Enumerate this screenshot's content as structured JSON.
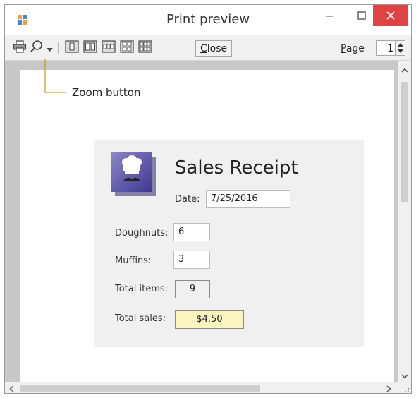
{
  "window": {
    "title": "Print preview",
    "icon": "app-icon",
    "controls": [
      "minimize-icon",
      "maximize-icon",
      "close-icon"
    ],
    "close_color": "#e04343"
  },
  "toolbar": {
    "icons": [
      "printer-icon",
      "zoom-magnifier-icon",
      "dropdown-arrow-icon",
      "one-page-icon",
      "two-pages-icon",
      "three-pages-icon",
      "four-pages-icon",
      "six-pages-icon"
    ],
    "close_label": "Close",
    "page_label": "Page",
    "page_value": "1"
  },
  "callout": {
    "text": "Zoom button",
    "border_color": "#c9a227"
  },
  "form": {
    "title": "Sales Receipt",
    "date_label": "Date:",
    "date_value": "7/25/2016",
    "doughnuts_label": "Doughnuts:",
    "doughnuts_value": "6",
    "muffins_label": "Muffins:",
    "muffins_value": "3",
    "total_items_label": "Total items:",
    "total_items_value": "9",
    "total_sales_label": "Total sales:",
    "total_sales_value": "$4.50",
    "total_sales_color": "#fbf4bf",
    "logo": "chef-hat-mustache-logo"
  }
}
